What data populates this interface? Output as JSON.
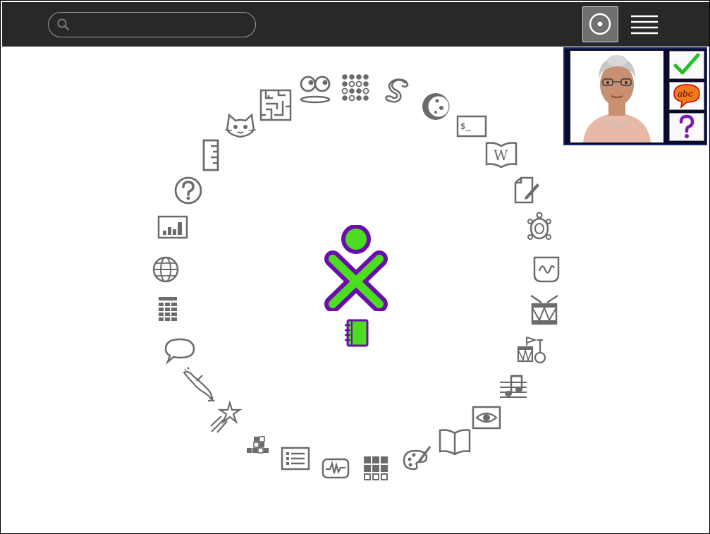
{
  "search": {
    "placeholder": "",
    "value": ""
  },
  "toolbar": {
    "view_icon": "home-view-icon",
    "menu_icon": "hamburger-menu-icon"
  },
  "colors": {
    "bar": "#282828",
    "icon_gray": "#6b6b6b",
    "xo_stroke": "#6a0dad",
    "xo_fill": "#4cdc20"
  },
  "center": {
    "owner_icon": "xo-person-icon",
    "journal_icon": "journal-icon"
  },
  "activities": [
    {
      "name": "write-icon"
    },
    {
      "name": "turtle-art-icon"
    },
    {
      "name": "measure-icon"
    },
    {
      "name": "drum-icon"
    },
    {
      "name": "tamtam-jam-icon"
    },
    {
      "name": "tamtam-edit-icon"
    },
    {
      "name": "record-icon"
    },
    {
      "name": "read-book-icon"
    },
    {
      "name": "paint-icon"
    },
    {
      "name": "memorize-grid-icon"
    },
    {
      "name": "scope-icon"
    },
    {
      "name": "list-icon"
    },
    {
      "name": "blocks-icon"
    },
    {
      "name": "star-chart-icon"
    },
    {
      "name": "dolphin-icon"
    },
    {
      "name": "chat-icon"
    },
    {
      "name": "calculator-icon"
    },
    {
      "name": "browse-globe-icon"
    },
    {
      "name": "chart-icon"
    },
    {
      "name": "help-icon"
    },
    {
      "name": "ruler-icon"
    },
    {
      "name": "scratch-cat-icon"
    },
    {
      "name": "maze-icon"
    },
    {
      "name": "eyes-icon"
    },
    {
      "name": "abacus-icon"
    },
    {
      "name": "pippy-snake-icon"
    },
    {
      "name": "moon-icon"
    },
    {
      "name": "terminal-icon"
    },
    {
      "name": "wikipedia-icon"
    }
  ],
  "tutor": {
    "check_icon": "checkmark-icon",
    "spell_icon": "abc-speech-icon",
    "help_icon": "question-icon"
  }
}
